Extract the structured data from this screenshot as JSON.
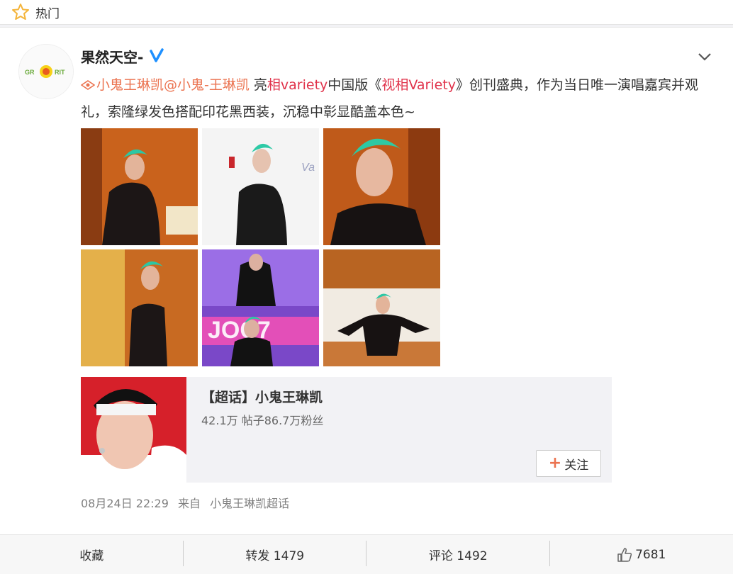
{
  "topbar": {
    "label": "热门",
    "icon": "star-outline-icon"
  },
  "post": {
    "username": "果然天空-",
    "verified_icon": "verified-v-icon",
    "avatar_text": "GR S RIT",
    "text_part1_link": "小鬼王琳凯",
    "text_part1_at": "@小鬼-王琳凯",
    "text_part2_a": " 亮",
    "text_part2_link": "相variety",
    "text_part2_b": "中国版《",
    "text_part2_link2": "视相Variety",
    "text_part2_c": "》创刊盛典，作为当日唯一演唱嘉宾并观礼，索隆绿发色搭配印花黑西装，沉稳中彰显酷盖本色~",
    "photos": [
      {
        "desc": "green-haired man in black suit, orange room"
      },
      {
        "desc": "green-haired man at press wall"
      },
      {
        "desc": "close-up green-haired man"
      },
      {
        "desc": "standing by curtain"
      },
      {
        "desc": "performing on stage"
      },
      {
        "desc": "sitting on bed"
      }
    ],
    "photo_wall_text": "Va",
    "stage_text": "JOC7",
    "topic": {
      "title": "【超话】小鬼王琳凯",
      "meta": "42.1万 帖子86.7万粉丝",
      "follow_label": "关注"
    },
    "time": "08月24日 22:29",
    "source_prefix": "来自",
    "source": "小鬼王琳凯超话"
  },
  "actions": {
    "favorite": "收藏",
    "repost": "转发 1479",
    "comment": "评论 1492",
    "like": "7681"
  },
  "colors": {
    "link": "#eb7350",
    "accent_red": "#e0324a",
    "verified": "#1e90ff"
  }
}
